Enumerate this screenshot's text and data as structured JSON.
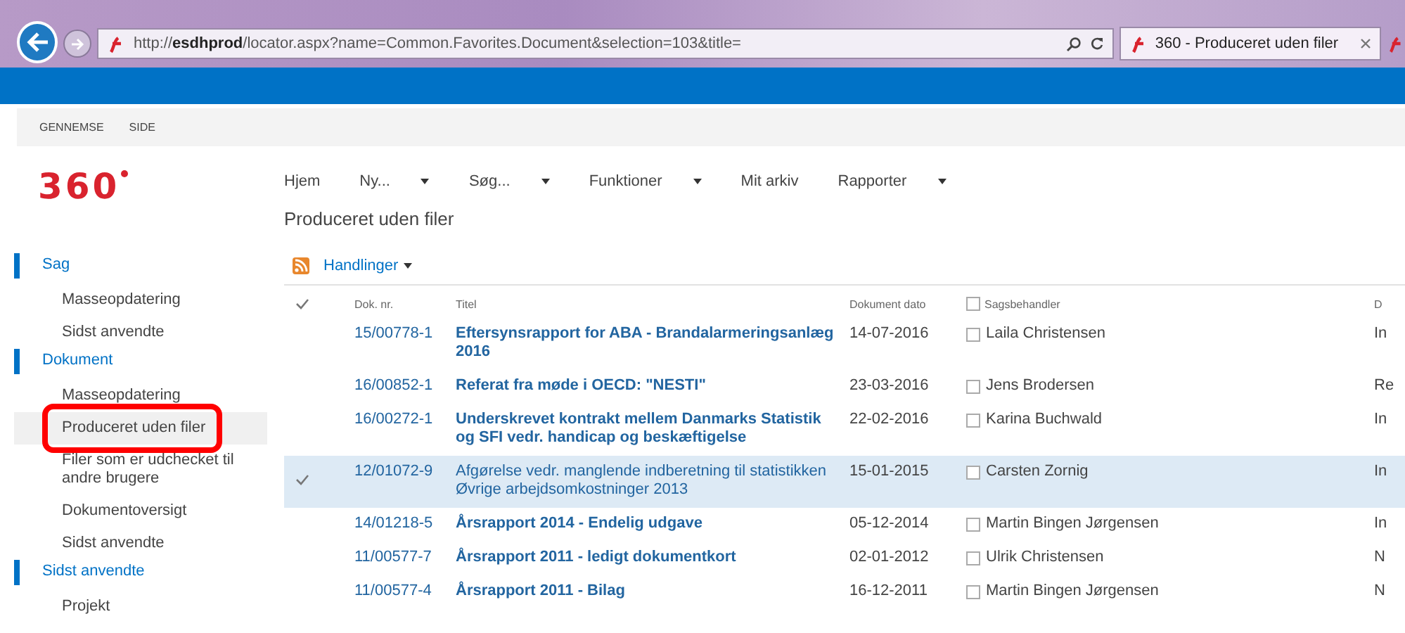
{
  "browser": {
    "url": "http://**esdhprod**/locator.aspx?name=Common.Favorites.Document&selection=103&title=",
    "tabs": [
      {
        "title": "360 - Produceret uden filer",
        "selected": true
      }
    ]
  },
  "ribbon": {
    "tabs": [
      "GENNEMSE",
      "SIDE"
    ]
  },
  "logo": "360",
  "nav": [
    {
      "label": "Hjem",
      "dropdown": false
    },
    {
      "label": "Ny...",
      "dropdown": true
    },
    {
      "label": "Søg...",
      "dropdown": true
    },
    {
      "label": "Funktioner",
      "dropdown": true
    },
    {
      "label": "Mit arkiv",
      "dropdown": false
    },
    {
      "label": "Rapporter",
      "dropdown": true
    }
  ],
  "page_title": "Produceret uden filer",
  "sidebar": [
    {
      "label": "Sag",
      "children": [
        {
          "label": "Masseopdatering",
          "selected": false
        },
        {
          "label": "Sidst anvendte",
          "selected": false
        }
      ]
    },
    {
      "label": "Dokument",
      "children": [
        {
          "label": "Masseopdatering",
          "selected": false
        },
        {
          "label": "Produceret uden filer",
          "selected": true
        },
        {
          "label": "Filer som er udchecket til andre brugere",
          "selected": false
        },
        {
          "label": "Dokumentoversigt",
          "selected": false
        },
        {
          "label": "Sidst anvendte",
          "selected": false
        }
      ]
    },
    {
      "label": "Sidst anvendte",
      "children": [
        {
          "label": "Projekt",
          "selected": false
        }
      ]
    }
  ],
  "actions": "Handlinger",
  "table": {
    "columns": [
      "Dok. nr.",
      "Titel",
      "Dokument dato",
      "Sagsbehandler",
      "D"
    ],
    "handler_header_checked": false,
    "rows": [
      {
        "doc": "15/00778-1",
        "title": "Eftersynsrapport for ABA - Brandalarmeringsanlæg 2016",
        "date": "14-07-2016",
        "handler": "Laila Christensen",
        "handler_checked": false,
        "column_5": "In",
        "bold": true,
        "selected": false
      },
      {
        "doc": "16/00852-1",
        "title": "Referat fra møde i OECD: \"NESTI\"",
        "date": "23-03-2016",
        "handler": "Jens Brodersen",
        "handler_checked": false,
        "column_5": "Re",
        "bold": true,
        "selected": false
      },
      {
        "doc": "16/00272-1",
        "title": "Underskrevet kontrakt mellem Danmarks Statistik og SFI vedr. handicap og beskæftigelse",
        "date": "22-02-2016",
        "handler": "Karina Buchwald",
        "handler_checked": false,
        "column_5": "In",
        "bold": true,
        "selected": false
      },
      {
        "doc": "12/01072-9",
        "title": "Afgørelse vedr. manglende indberetning til statistikken Øvrige arbejdsomkostninger 2013",
        "date": "15-01-2015",
        "handler": "Carsten Zornig",
        "handler_checked": false,
        "column_5": "In",
        "bold": false,
        "selected": true
      },
      {
        "doc": "14/01218-5",
        "title": "Årsrapport 2014 - Endelig udgave",
        "date": "05-12-2014",
        "handler": "Martin Bingen Jørgensen",
        "handler_checked": false,
        "column_5": "In",
        "bold": true,
        "selected": false
      },
      {
        "doc": "11/00577-7",
        "title": "Årsrapport 2011 - ledigt dokumentkort",
        "date": "02-01-2012",
        "handler": "Ulrik Christensen",
        "handler_checked": false,
        "column_5": "N",
        "bold": true,
        "selected": false
      },
      {
        "doc": "11/00577-4",
        "title": "Årsrapport 2011 - Bilag",
        "date": "16-12-2011",
        "handler": "Martin Bingen Jørgensen",
        "handler_checked": false,
        "column_5": "N",
        "bold": true,
        "selected": false
      }
    ]
  }
}
